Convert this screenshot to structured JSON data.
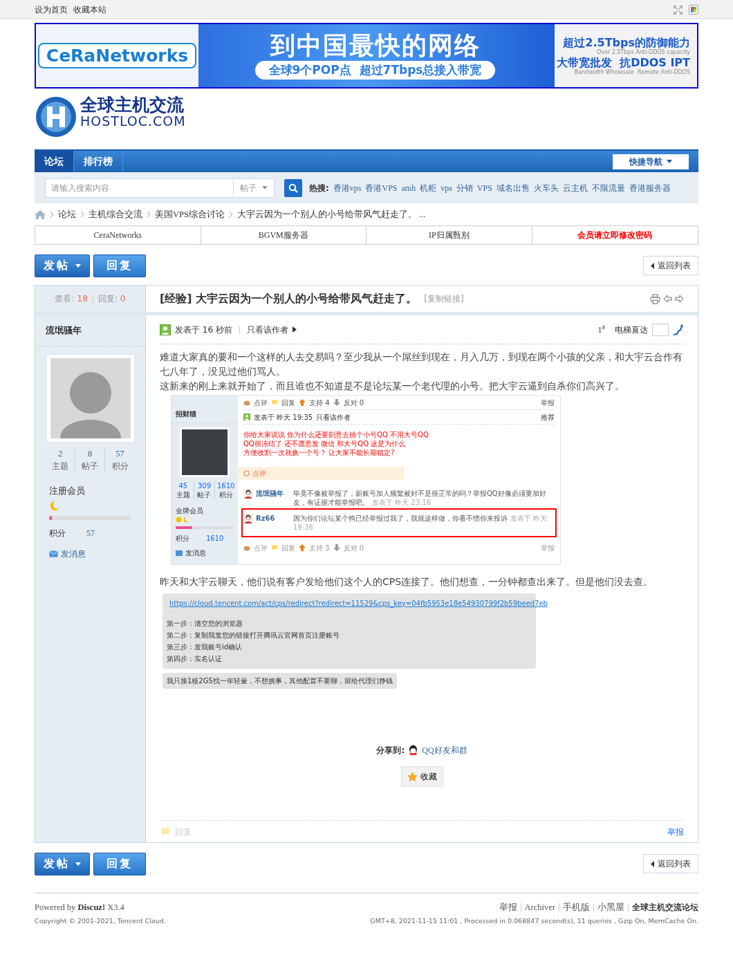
{
  "topbar": {
    "links": [
      "设为首页",
      "收藏本站"
    ]
  },
  "banner": {
    "brand": "CeRaNetworks",
    "headline": "到中国最快的网络",
    "subline": "全球9个POP点  超过7Tbps总接入带宽",
    "right_lines": [
      {
        "text": "超过2.5Tbps的防御能力",
        "kind": "main"
      },
      {
        "text": "Over 2.5Tbps Anti-DDOS capacity",
        "kind": "sub"
      },
      {
        "text": "大带宽批发  抗DDOS IPT",
        "kind": "main"
      },
      {
        "text": "Bandwidth Wholesale  Remote Anti-DDOS",
        "kind": "sub"
      }
    ]
  },
  "logo": {
    "title": "全球主机交流",
    "domain": "HOSTLOC.COM"
  },
  "nav": {
    "items": [
      {
        "label": "论坛",
        "selected": true
      },
      {
        "label": "排行榜",
        "selected": false
      }
    ],
    "quick_nav": "快捷导航"
  },
  "search": {
    "placeholder": "请输入搜索内容",
    "scope": "帖子",
    "hot_label": "热搜:",
    "hot": [
      "香港vps",
      "香港VPS",
      "amh",
      "机柜",
      "vps",
      "分销",
      "VPS",
      "域名出售",
      "火车头",
      "云主机",
      "不限流量",
      "香港服务器"
    ]
  },
  "breadcrumb": [
    "论坛",
    "主机综合交流",
    "美国VPS综合讨论",
    "大宇云因为一个别人的小号给带风气赶走了。 ..."
  ],
  "links_bar": [
    {
      "label": "CeraNetworks",
      "emphasized": false
    },
    {
      "label": "BGVM服务器",
      "emphasized": false
    },
    {
      "label": "IP归属甄别",
      "emphasized": false
    },
    {
      "label": "会员请立即修改密码",
      "emphasized": true
    }
  ],
  "actions_top": {
    "post": "发帖",
    "reply": "回复",
    "back": "返回列表"
  },
  "thread": {
    "views_label": "查看:",
    "views": "18",
    "replies_label": "回复:",
    "replies": "0",
    "tag": "[经验]",
    "title": "大宇云因为一个别人的小号给带风气赶走了。",
    "copy_link": "[复制链接]"
  },
  "author": {
    "name": "流氓骚年",
    "stats": [
      {
        "value": "2",
        "label": "主题"
      },
      {
        "value": "8",
        "label": "帖子"
      },
      {
        "value": "57",
        "label": "积分"
      }
    ],
    "group": "注册会员",
    "level": 0.03,
    "points_label": "积分",
    "points": "57",
    "message": "发消息"
  },
  "post": {
    "posted": "发表于 16 秒前",
    "author_only": "只看该作者",
    "floor": "1$^{#}$",
    "elevator": "电梯直达",
    "paragraphs": [
      "难道大家真的要和一个这样的人去交易吗？至少我从一个屌丝到现在，月入几万，到现在两个小孩的父亲，和大宇云合作有七八年了，没见过他们骂人。",
      "这新来的刚上来就开始了，而且谁也不知道是不是论坛某一个老代理的小号。把大宇云逼到自杀你们高兴了。"
    ],
    "embedded": {
      "top_actions": [
        "点评",
        "回复",
        "支持 4",
        "反对 0"
      ],
      "top_report": "举报",
      "author": {
        "name": "招财猫",
        "stats": [
          {
            "value": "45",
            "label": "主题"
          },
          {
            "value": "309",
            "label": "帖子"
          },
          {
            "value": "1610",
            "label": "积分"
          }
        ],
        "group": "金牌会员",
        "level": 0.28,
        "points_label": "积分",
        "points": "1610",
        "message": "发消息"
      },
      "posted": "发表于 昨天 19:35",
      "author_only": "只看该作者",
      "recommend": "推荐",
      "red_lines": [
        "你给大家说说 你为什么还要刻意去搞个小号QQ  不用大号QQ",
        "QQ很冻结了 还不愿意发 微信  和大号QQ  这是为什么",
        "方便收割一次就换一个号？  让大家不能长期稳定?"
      ],
      "review_label": "点评",
      "comments": [
        {
          "user": "流氓骚年",
          "text": "毕竟不像被举报了，新账号加人频繁被封不是很正常的吗？举报QQ好像必须要加好友，有证据才能举报吧。",
          "time": "发表于 昨天 23:16",
          "highlighted": false
        },
        {
          "user": "Rz66",
          "text": "因为你们论坛某个狗已经举报过我了，我就这样做，你看不惯你来投诉",
          "time": "发表于 昨天 19:36",
          "highlighted": true
        }
      ],
      "bottom_actions": [
        "点评",
        "回复",
        "支持 3",
        "反对 0"
      ],
      "bottom_report": "举报"
    },
    "paragraph2": "昨天和大宇云聊天，他们说有客户发给他们这个人的CPS连接了。他们想查，一分钟都查出来了。但是他们没去查。",
    "chat": {
      "link": "https://cloud.tencent.com/act/cps/redirect?redirect=11529&cps_key=04fb5953e18e54930799f2b59beed7eb",
      "steps": [
        "第一步：清空您的浏览器",
        "第二步：复制我发您的链接打开腾讯云官网首页注册账号",
        "第三步：发我账号id确认",
        "第四步：实名认证"
      ],
      "note": "我只接1核2G5找一年轻量，不想挑事，其他配置不要聊，留给代理们挣钱"
    },
    "share_label": "分享到:",
    "share": "QQ好友和群",
    "favorite": "收藏",
    "reply": "回复",
    "report": "举报"
  },
  "actions_bottom": {
    "post": "发帖",
    "reply": "回复",
    "back": "返回列表"
  },
  "footer": {
    "powered_prefix": "Powered by",
    "product": "Discuz!",
    "version": "X3.4",
    "links": [
      "举报",
      "Archiver",
      "手机版",
      "小黑屋",
      "全球主机交流论坛"
    ],
    "copyright": "Copyright © 2001-2021, Tencent Cloud.",
    "stats": "GMT+8, 2021-11-15 11:01 , Processed in 0.068847 second(s), 11 queries , Gzip On, MemCache On."
  }
}
